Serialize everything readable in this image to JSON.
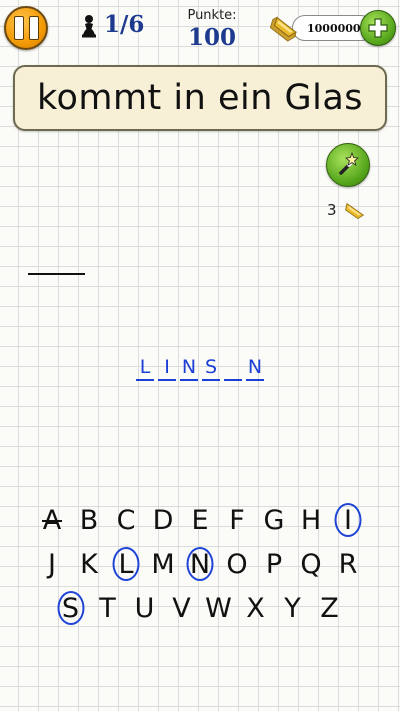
{
  "header": {
    "level": "1/6",
    "score_label": "Punkte:",
    "score_value": "100",
    "coins": "1000000",
    "pause_icon": "pause-icon",
    "pawn_icon": "pawn-icon",
    "gold_icon": "gold-bar-icon",
    "plus_icon": "plus-icon"
  },
  "clue": "kommt in ein Glas",
  "hint": {
    "cost": "3",
    "icon": "magic-wand-icon"
  },
  "word": {
    "letters": [
      "L",
      "I",
      "N",
      "S",
      "",
      "N"
    ]
  },
  "keyboard": {
    "rows": [
      [
        "A",
        "B",
        "C",
        "D",
        "E",
        "F",
        "G",
        "H",
        "I"
      ],
      [
        "J",
        "K",
        "L",
        "M",
        "N",
        "O",
        "P",
        "Q",
        "R"
      ],
      [
        "S",
        "T",
        "U",
        "V",
        "W",
        "X",
        "Y",
        "Z"
      ]
    ],
    "circled": [
      "I",
      "L",
      "N",
      "S"
    ],
    "crossed": [
      "A"
    ]
  },
  "colors": {
    "accent_blue": "#1b3fd6",
    "orange": "#f39a06",
    "green": "#55a51b",
    "clue_bg": "#f7f0d7"
  }
}
